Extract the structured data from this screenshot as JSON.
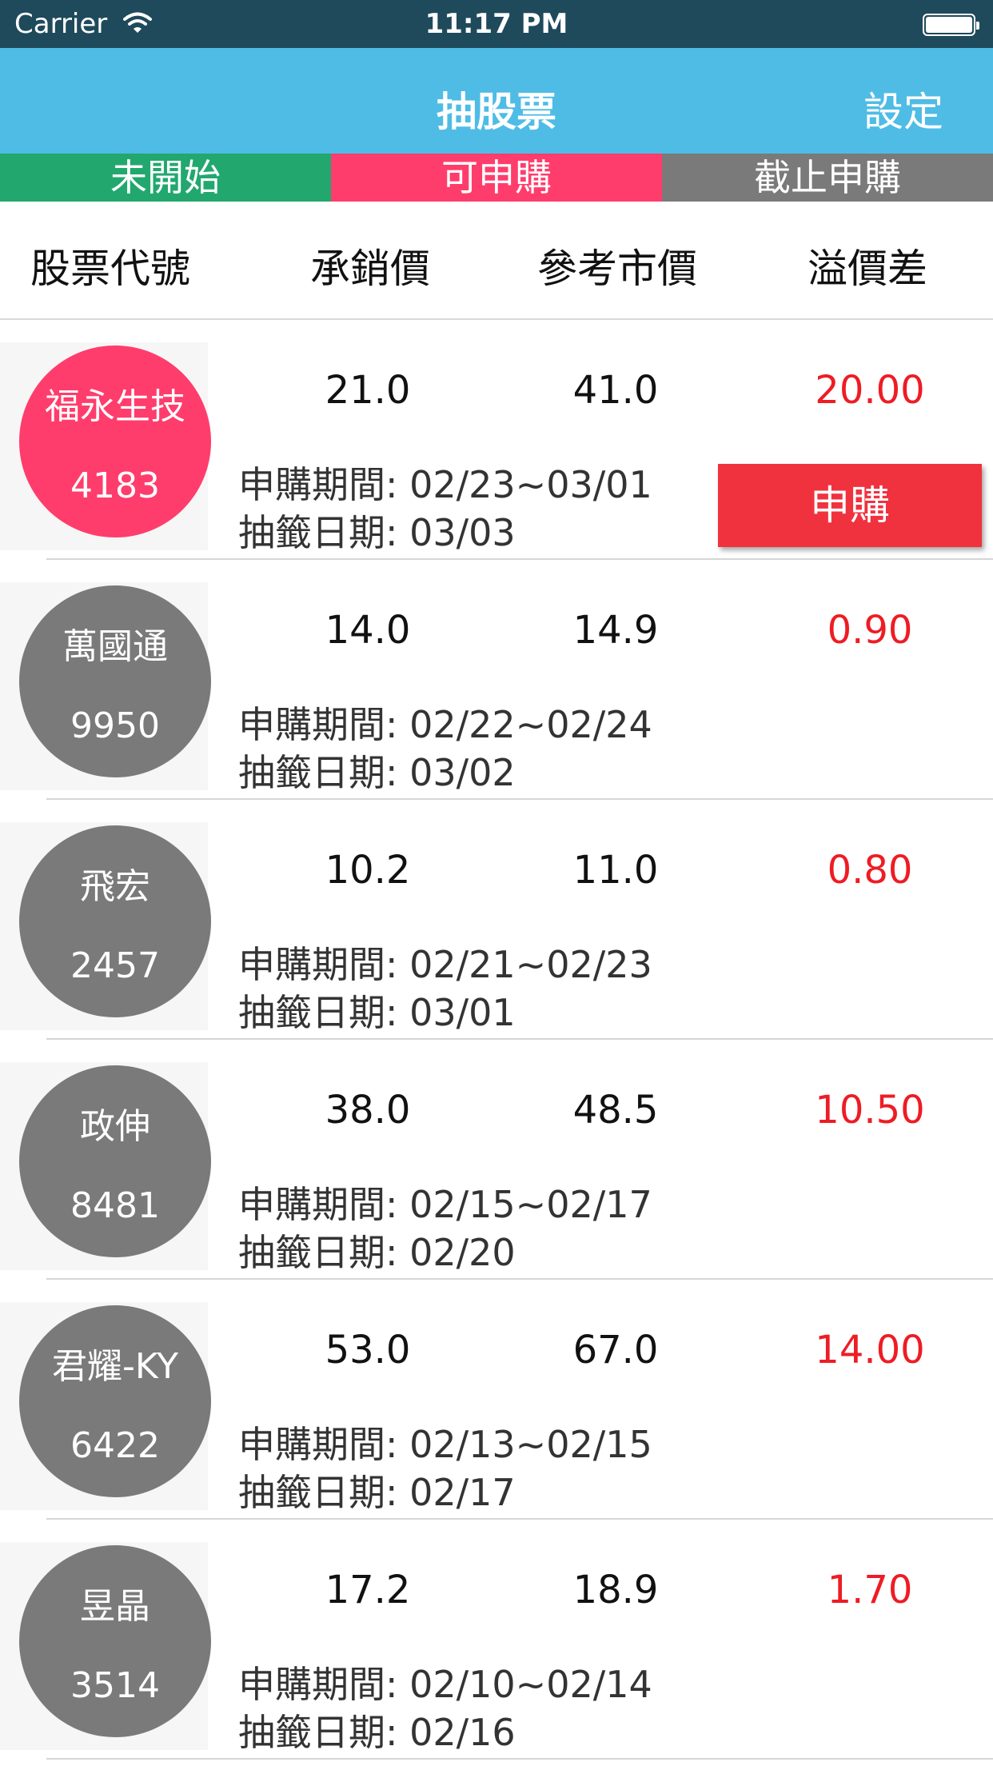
{
  "status_bar": {
    "carrier": "Carrier",
    "time": "11:17 PM"
  },
  "nav": {
    "title": "抽股票",
    "settings_label": "設定"
  },
  "tabs": [
    {
      "label": "未開始",
      "color": "#22a86f"
    },
    {
      "label": "可申購",
      "color": "#ff3d6c"
    },
    {
      "label": "截止申購",
      "color": "#7a7a7a"
    }
  ],
  "columns": {
    "code": "股票代號",
    "ipo_price": "承銷價",
    "ref_price": "參考市價",
    "premium": "溢價差"
  },
  "colors": {
    "accent": "#4fbce6",
    "premium_red": "#ee1c24",
    "active_circle": "#ff3d6c",
    "inactive_circle": "#7a7a7a",
    "button_red": "#f0323f"
  },
  "stocks": [
    {
      "name": "福永生技",
      "code": "4183",
      "ipo_price": "21.0",
      "ref_price": "41.0",
      "premium": "20.00",
      "period": "申購期間: 02/23~03/01",
      "draw_date": "抽籤日期: 03/03",
      "circle_color": "#ff3d6c",
      "button_label": "申購"
    },
    {
      "name": "萬國通",
      "code": "9950",
      "ipo_price": "14.0",
      "ref_price": "14.9",
      "premium": "0.90",
      "period": "申購期間: 02/22~02/24",
      "draw_date": "抽籤日期: 03/02",
      "circle_color": "#7a7a7a"
    },
    {
      "name": "飛宏",
      "code": "2457",
      "ipo_price": "10.2",
      "ref_price": "11.0",
      "premium": "0.80",
      "period": "申購期間: 02/21~02/23",
      "draw_date": "抽籤日期: 03/01",
      "circle_color": "#7a7a7a"
    },
    {
      "name": "政伸",
      "code": "8481",
      "ipo_price": "38.0",
      "ref_price": "48.5",
      "premium": "10.50",
      "period": "申購期間: 02/15~02/17",
      "draw_date": "抽籤日期: 02/20",
      "circle_color": "#7a7a7a"
    },
    {
      "name": "君耀-KY",
      "code": "6422",
      "ipo_price": "53.0",
      "ref_price": "67.0",
      "premium": "14.00",
      "period": "申購期間: 02/13~02/15",
      "draw_date": "抽籤日期: 02/17",
      "circle_color": "#7a7a7a"
    },
    {
      "name": "昱晶",
      "code": "3514",
      "ipo_price": "17.2",
      "ref_price": "18.9",
      "premium": "1.70",
      "period": "申購期間: 02/10~02/14",
      "draw_date": "抽籤日期: 02/16",
      "circle_color": "#7a7a7a"
    }
  ]
}
